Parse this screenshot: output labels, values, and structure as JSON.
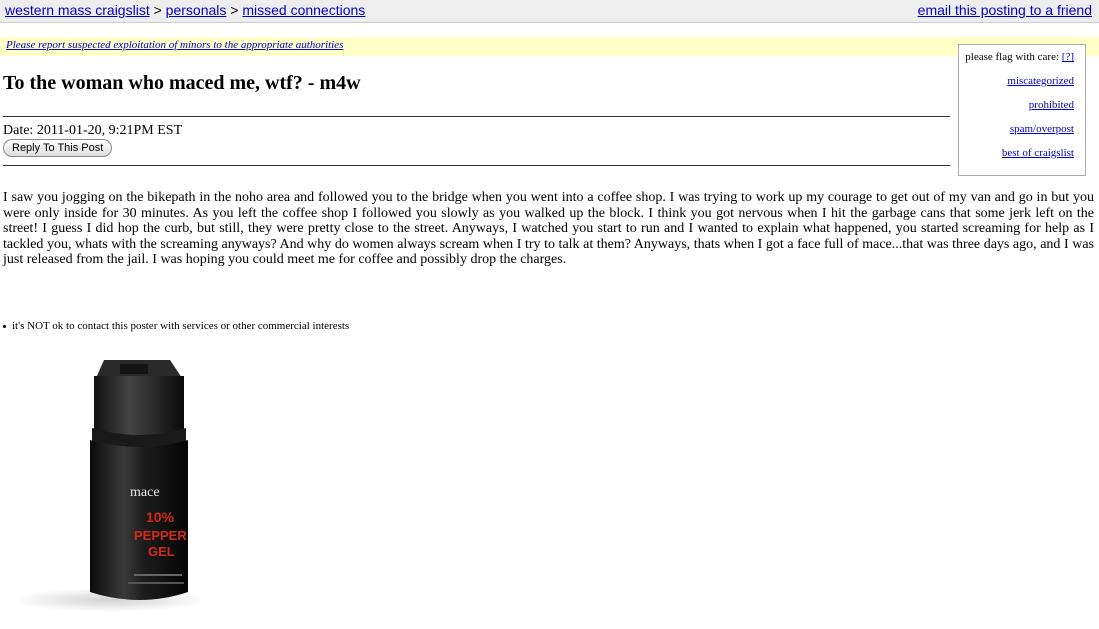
{
  "breadcrumb": {
    "site": "western mass craigslist",
    "separator": ">",
    "section": "personals",
    "category": "missed connections"
  },
  "email_link": "email this posting to a friend",
  "warning": "Please report suspected exploitation of minors to the appropriate authorities",
  "flag": {
    "heading": "please flag with care:",
    "help": "[?]",
    "options": [
      "miscategorized",
      "prohibited",
      "spam/overpost",
      "best of craigslist"
    ]
  },
  "post": {
    "title": "To the woman who maced me, wtf? - m4w",
    "date": "Date: 2011-01-20, 9:21PM EST",
    "reply_button": "Reply To This Post",
    "body": "I saw you jogging on the bikepath in the noho area and followed you to the bridge when you went into a coffee shop. I was trying to work up my courage to get out of my van and go in but you were only inside for 30 minutes. As you left the coffee shop I followed you slowly as you walked up the block. I think you got nervous when I hit the garbage cans that some jerk left on the street! I guess I did hop the curb, but still, they were pretty close to the street. Anyways, I watched you start to run and I wanted to explain what happened, you started screaming for help as I tackled you, whats with the screaming anyways? And why do women always scream when I try to talk at them? Anyways, thats when I got a face full of mace...that was three days ago, and I was just released from the jail. I was hoping you could meet me for coffee and possibly drop the charges.",
    "notes": [
      "it's NOT ok to contact this poster with services or other commercial interests"
    ]
  },
  "image": {
    "subject": "pepper spray canister",
    "label_brand": "mace",
    "label_line1": "10%",
    "label_line2": "PEPPER",
    "label_line3": "GEL"
  },
  "colors": {
    "link": "#0000cc",
    "topbar_bg": "#eeeeee",
    "warning_bg": "#ffffc8",
    "label_red": "#d42a1a"
  }
}
